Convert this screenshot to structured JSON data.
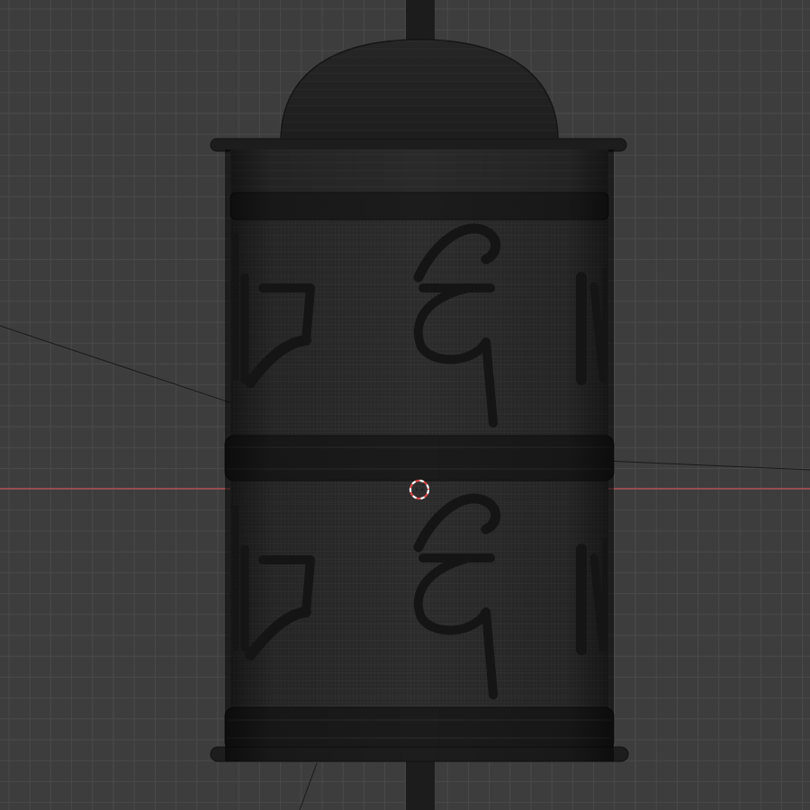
{
  "app": "3D viewport",
  "viewport": {
    "view": "front-orthographic",
    "shading": "wireframe",
    "background_color": "#3d3d3d",
    "grid_color": "#4a4a4a",
    "x_axis_color": "#c4555a",
    "object": {
      "type": "prayer-wheel-mesh",
      "mesh_color": "#2a2a2a",
      "band_color": "#1b1b1b",
      "glyph_color": "#141414"
    },
    "cursor": {
      "type": "3d-cursor",
      "colors": [
        "#d94a4a",
        "#ffffff"
      ]
    }
  }
}
